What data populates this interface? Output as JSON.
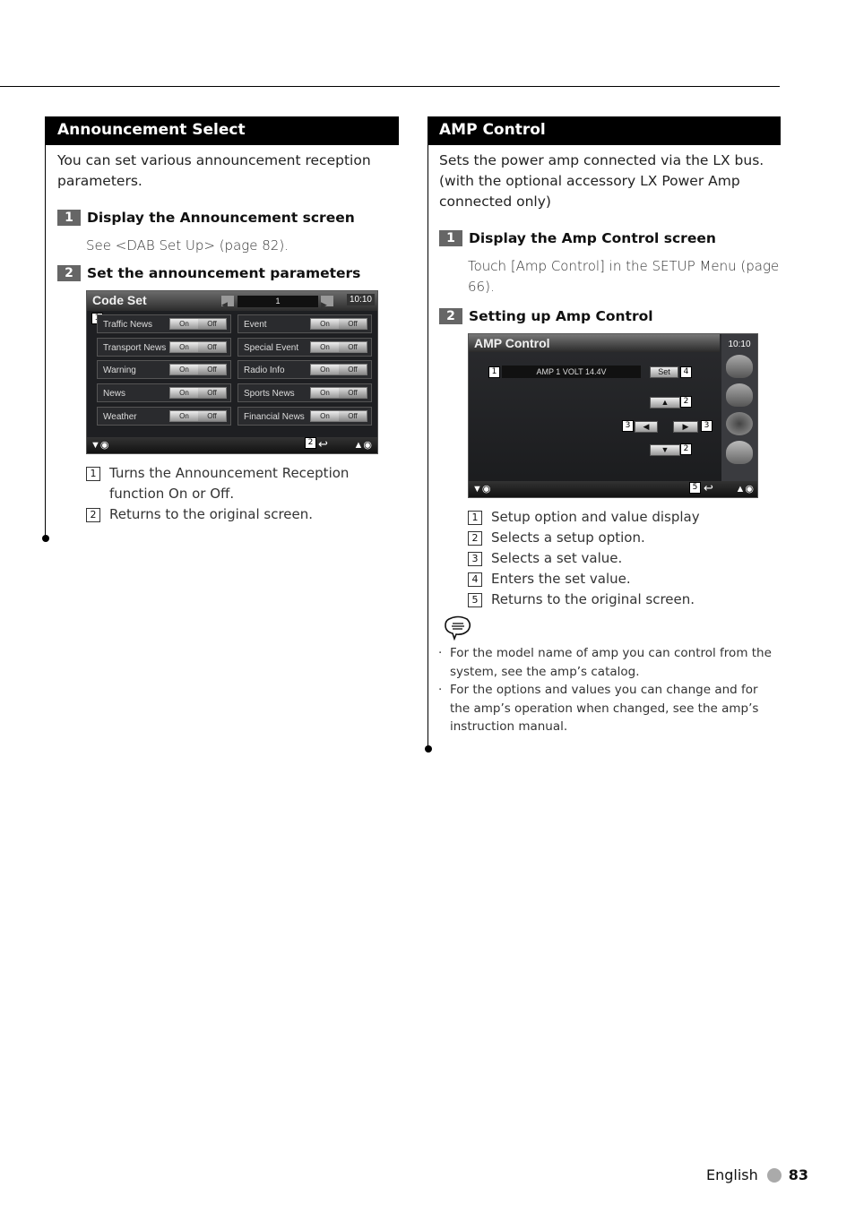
{
  "left": {
    "title": "Announcement Select",
    "intro": "You can set various announcement reception parameters.",
    "steps": [
      {
        "num": "1",
        "title": "Display the Announcement screen",
        "desc": "See <DAB Set Up> (page 82)."
      },
      {
        "num": "2",
        "title": "Set the announcement parameters"
      }
    ],
    "screen": {
      "title": "Code Set",
      "page": "1",
      "clock": "10:10",
      "rows": [
        {
          "label": "Traffic News",
          "on": "On",
          "off": "Off"
        },
        {
          "label": "Transport News",
          "on": "On",
          "off": "Off"
        },
        {
          "label": "Warning",
          "on": "On",
          "off": "Off"
        },
        {
          "label": "News",
          "on": "On",
          "off": "Off"
        },
        {
          "label": "Weather",
          "on": "On",
          "off": "Off"
        },
        {
          "label": "Event",
          "on": "On",
          "off": "Off"
        },
        {
          "label": "Special Event",
          "on": "On",
          "off": "Off"
        },
        {
          "label": "Radio Info",
          "on": "On",
          "off": "Off"
        },
        {
          "label": "Sports News",
          "on": "On",
          "off": "Off"
        },
        {
          "label": "Financial News",
          "on": "On",
          "off": "Off"
        }
      ],
      "markers": [
        "1",
        "2"
      ]
    },
    "callouts": [
      {
        "num": "1",
        "text": "Turns the Announcement Reception function On or Off."
      },
      {
        "num": "2",
        "text": "Returns to the original screen."
      }
    ]
  },
  "right": {
    "title": "AMP Control",
    "intro": "Sets the power amp connected via the LX bus. (with the optional accessory LX Power Amp connected only)",
    "steps": [
      {
        "num": "1",
        "title": "Display the Amp Control screen",
        "desc": "Touch [Amp Control] in the SETUP Menu (page 66)."
      },
      {
        "num": "2",
        "title": "Setting up Amp Control"
      }
    ],
    "screen": {
      "title": "AMP Control",
      "clock": "10:10",
      "value_display": "AMP 1 VOLT 14.4V",
      "set_label": "Set",
      "up_glyph": "▲",
      "down_glyph": "▼",
      "left_glyph": "◀",
      "right_glyph": "▶",
      "markers": [
        "1",
        "2",
        "3",
        "4",
        "5"
      ]
    },
    "callouts": [
      {
        "num": "1",
        "text": "Setup option and value display"
      },
      {
        "num": "2",
        "text": "Selects a setup option."
      },
      {
        "num": "3",
        "text": "Selects a set value."
      },
      {
        "num": "4",
        "text": "Enters the set value."
      },
      {
        "num": "5",
        "text": "Returns to the original screen."
      }
    ],
    "notes": [
      "For the model name of amp you can control from the system, see the amp’s catalog.",
      "For the options and values you can change and for the amp’s operation when changed, see the amp’s instruction manual."
    ]
  },
  "footer": {
    "language": "English",
    "page": "83"
  }
}
